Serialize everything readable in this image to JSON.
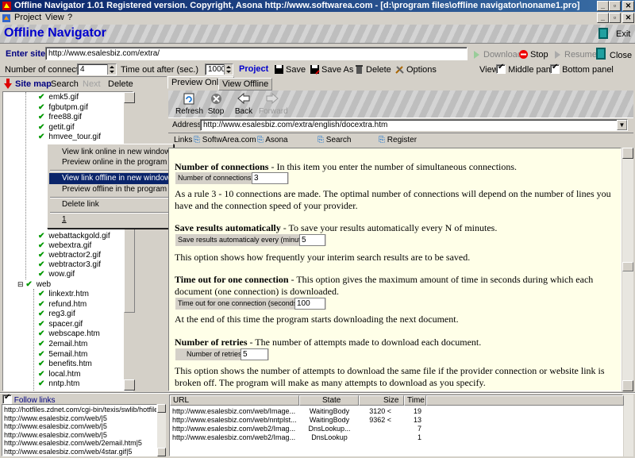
{
  "window": {
    "title": "Offline Navigator 1.01  Registered version.  Copyright,  Asona  http://www.softwarea.com - [d:\\program files\\offline navigator\\noname1.pro]"
  },
  "menu": {
    "project": "Project",
    "view": "View",
    "help": "?"
  },
  "banner": {
    "brand": "Offline Navigator",
    "exit": "Exit"
  },
  "site": {
    "label": "Enter site",
    "url": "http://www.esalesbiz.com/extra/"
  },
  "actions": {
    "download": "Download",
    "stop": "Stop",
    "resume": "Resume",
    "close": "Close"
  },
  "options_bar": {
    "connections_label": "Number of connections",
    "connections_value": "4",
    "timeout_label": "Time out after (sec.)",
    "timeout_value": "1000",
    "project_label": "Project",
    "save": "Save",
    "save_as": "Save As",
    "delete": "Delete",
    "options": "Options",
    "view_label": "View",
    "middle_panel": "Middle panel",
    "bottom_panel": "Bottom panel"
  },
  "left_tabs": {
    "site_map": "Site map",
    "search": "Search",
    "next": "Next",
    "delete": "Delete"
  },
  "tree": {
    "items_top": [
      "emk5.gif",
      "fgbutpm.gif",
      "free88.gif",
      "getit.gif",
      "hmvee_tour.gif"
    ],
    "items_mid": [
      "webattackgold.gif",
      "webextra.gif",
      "webtractor2.gif",
      "webtractor3.gif",
      "wow.gif"
    ],
    "folder": "web",
    "items_web": [
      "linkextr.htm",
      "refund.htm",
      "reg3.gif",
      "spacer.gif",
      "webscape.htm",
      "2email.htm",
      "5email.htm",
      "benefits.htm",
      "local.htm",
      "nntp.htm"
    ]
  },
  "context_menu": {
    "view_online_new": "View link online in new window...",
    "preview_online": "Preview online in the program",
    "view_offline_new": "View link offline in new window ...",
    "preview_offline": "Preview offline in the program",
    "delete_link": "Delete link",
    "number": "1"
  },
  "preview_tabs": {
    "online": "Preview Online",
    "offline": "View Offline"
  },
  "browser": {
    "refresh": "Refresh",
    "stop": "Stop",
    "back": "Back",
    "forward": "Forward",
    "address_label": "Address",
    "address": "http://www.esalesbiz.com/extra/english/docextra.htm",
    "links_label": "Links",
    "link1": "SoftwArea.com",
    "link2": "Asona",
    "link3": "Search",
    "link4": "Register"
  },
  "doc": {
    "h1": "Number of connections",
    "h1_rest": " - In this item you enter the number of simultaneous connections.",
    "c1_label": "Number of connections",
    "c1_value": "3",
    "p1a": "As a rule 3 - 10 connections are made. The optimal number of connections will depend on the number of lines you",
    "p1b": "have and the connection speed of your provider.",
    "h2": "Save results automatically",
    "h2_rest": " - To save your results automatically every N of minutes.",
    "c2_label": "Save results automaticaly every (minutes)",
    "c2_value": "5",
    "p2": "This option shows how frequently your interim search results are to be saved.",
    "h3": "Time out for one connection",
    "h3_rest": " - This option gives the maximum amount of time in seconds during which each",
    "h3_line2": "document (one connection) is downloaded.",
    "c3_label": "Time out for one connection (seconds)",
    "c3_value": "100",
    "p3": "At the end of this time the program starts downloading the next document.",
    "h4": "Number of retries",
    "h4_rest": " - The number of attempts made to download each document.",
    "c4_label": "Number of retries",
    "c4_value": "5",
    "p4a": "This option shows the number of attempts to download the same file if the provider connection or website link is",
    "p4b": "broken off. The program will make as many attempts to download as you specify."
  },
  "follow": {
    "label": "Follow links",
    "links": [
      "http://hotfiles.zdnet.com/cgi-bin/texis/swlib/hotfiles.",
      "http://www.esalesbiz.com/web/|5",
      "http://www.esalesbiz.com/web/|5",
      "http://www.esalesbiz.com/web/|5",
      "http://www.esalesbiz.com/web/2email.htm|5",
      "http://www.esalesbiz.com/web/4star.gif|5"
    ]
  },
  "downloads": {
    "headers": {
      "url": "URL",
      "state": "State",
      "size": "Size",
      "time": "Time"
    },
    "rows": [
      {
        "url": "http://www.esalesbiz.com/web/Image...",
        "state": "WaitingBody",
        "size": "3120 <",
        "time": "19"
      },
      {
        "url": "http://www.esalesbiz.com/web/nntplst...",
        "state": "WaitingBody",
        "size": "9362 <",
        "time": "13"
      },
      {
        "url": "http://www.esalesbiz.com/web2/Imag...",
        "state": "DnsLookup...",
        "size": "",
        "time": "7"
      },
      {
        "url": "http://www.esalesbiz.com/web2/Imag...",
        "state": "DnsLookup",
        "size": "",
        "time": "1"
      }
    ]
  }
}
